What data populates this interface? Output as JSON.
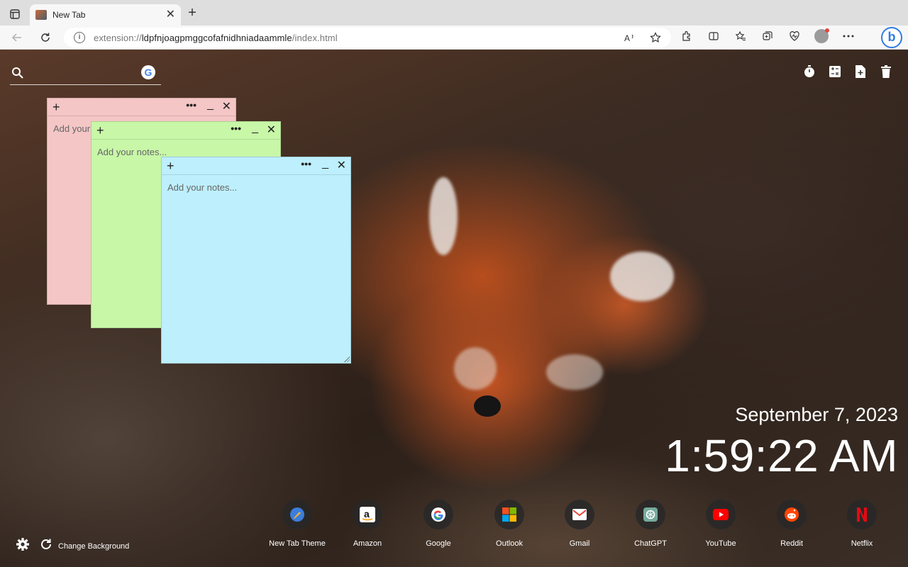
{
  "browser": {
    "tab_title": "New Tab",
    "tab_close": "✕",
    "new_tab": "+",
    "url_scheme": "extension://",
    "url_host": "ldpfnjoagpmggcofafnidhniadaammle",
    "url_path": "/index.html"
  },
  "search": {
    "placeholder": ""
  },
  "notes": [
    {
      "placeholder": "Add your notes...",
      "visible_text": "Add your"
    },
    {
      "placeholder": "Add your notes..."
    },
    {
      "placeholder": "Add your notes..."
    }
  ],
  "note_controls": {
    "add": "+",
    "more": "•••",
    "minimize": "_",
    "close": "✕"
  },
  "clock": {
    "date": "September 7, 2023",
    "time": "1:59:22 AM"
  },
  "footer": {
    "change_background": "Change Background"
  },
  "shortcuts": [
    {
      "label": "New Tab Theme",
      "icon": "new-tab-theme-icon",
      "color": "#3b7ddd"
    },
    {
      "label": "Amazon",
      "icon": "amazon-icon",
      "color": "#ffffff"
    },
    {
      "label": "Google",
      "icon": "google-icon",
      "color": "#ffffff"
    },
    {
      "label": "Outlook",
      "icon": "outlook-icon",
      "color": "#f25022"
    },
    {
      "label": "Gmail",
      "icon": "gmail-icon",
      "color": "#ea4335"
    },
    {
      "label": "ChatGPT",
      "icon": "chatgpt-icon",
      "color": "#74aa9c"
    },
    {
      "label": "YouTube",
      "icon": "youtube-icon",
      "color": "#ff0000"
    },
    {
      "label": "Reddit",
      "icon": "reddit-icon",
      "color": "#ff4500"
    },
    {
      "label": "Netflix",
      "icon": "netflix-icon",
      "color": "#e50914"
    }
  ]
}
